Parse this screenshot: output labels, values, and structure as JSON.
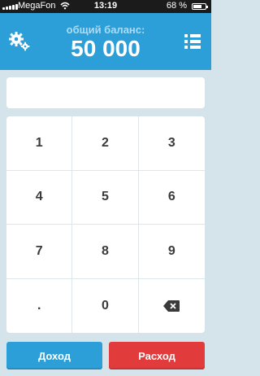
{
  "status_bar": {
    "carrier": "MegaFon",
    "time": "13:19",
    "battery": "68 %",
    "battery_level": 0.68
  },
  "header": {
    "subtitle": "общий баланс:",
    "balance": "50 000",
    "left_icon": "gear-icon",
    "right_icon": "list-icon",
    "color": "#2d9fd8"
  },
  "amount_input": {
    "value": "",
    "placeholder": ""
  },
  "keypad": {
    "keys": [
      "1",
      "2",
      "3",
      "4",
      "5",
      "6",
      "7",
      "8",
      "9",
      ".",
      "0",
      "⌫"
    ],
    "backspace_icon": "backspace-icon"
  },
  "actions": {
    "income_label": "Доход",
    "expense_label": "Расход",
    "income_color": "#2d9fd8",
    "expense_color": "#e23b3b"
  }
}
